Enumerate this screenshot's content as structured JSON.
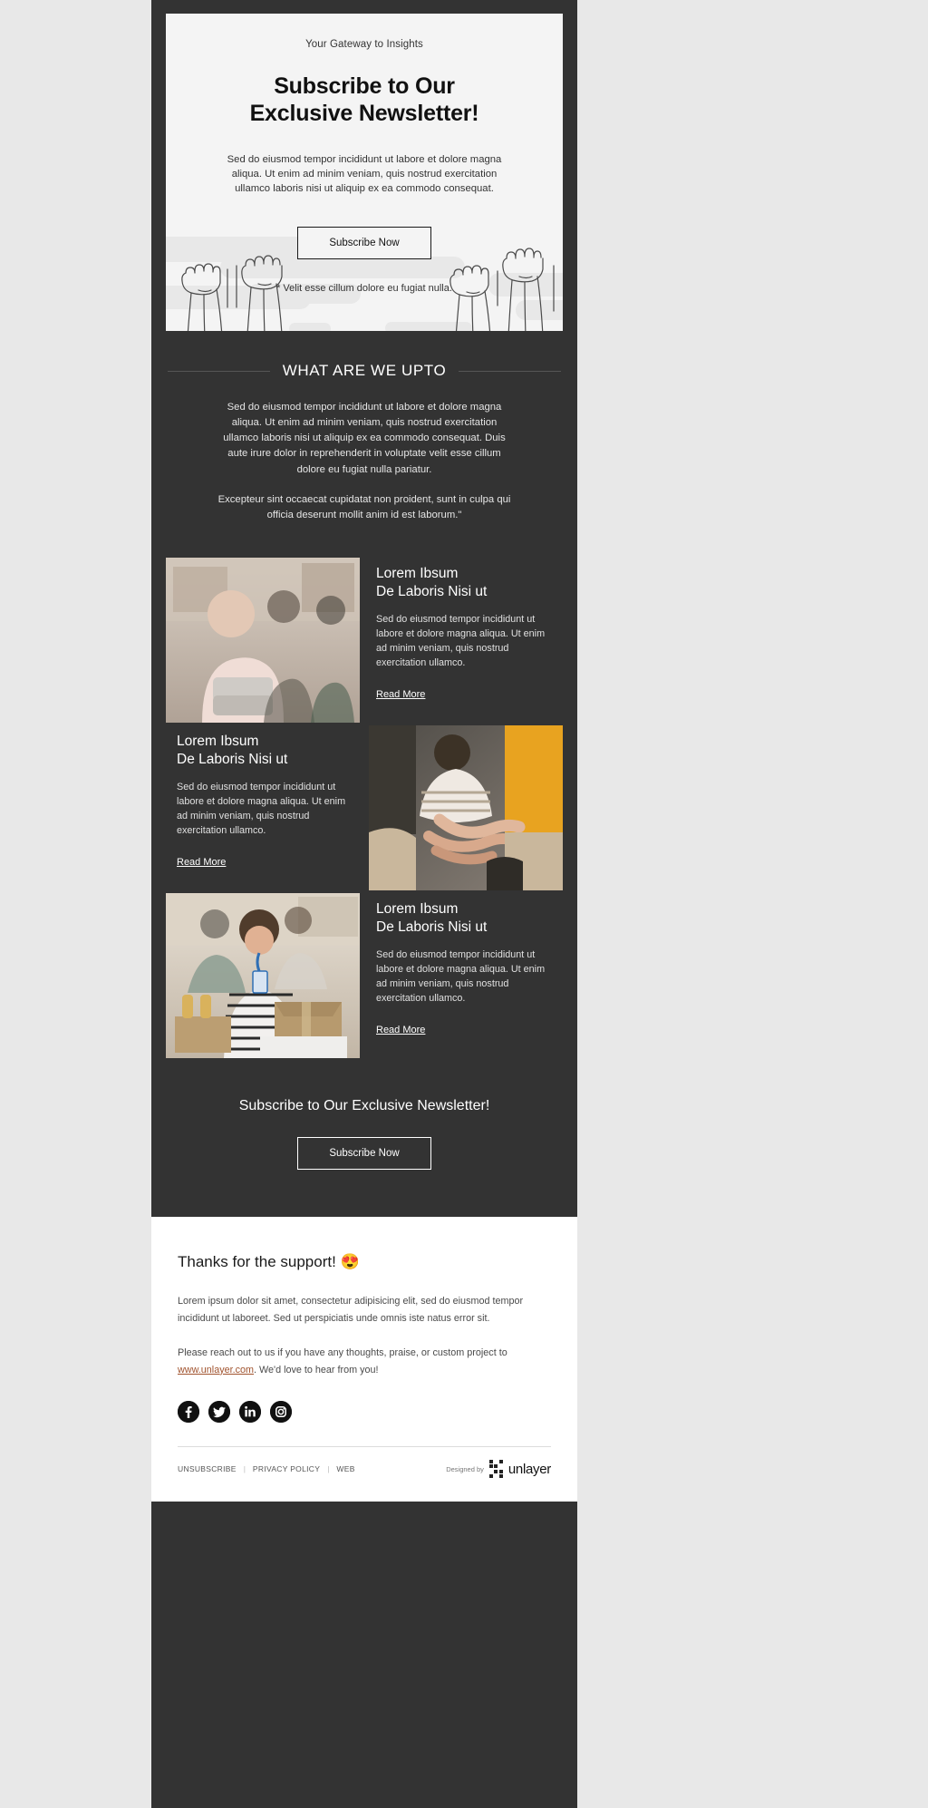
{
  "colors": {
    "email_bg": "#333333",
    "page_bg": "#e8e8e8",
    "hero_bg": "#f4f4f4",
    "footer_bg": "#ffffff",
    "accent_link": "#a0522d"
  },
  "hero": {
    "eyebrow": "Your Gateway to Insights",
    "title_line1": "Subscribe to Our",
    "title_line2": "Exclusive Newsletter!",
    "body": "Sed do eiusmod tempor incididunt ut labore et dolore magna aliqua. Ut enim ad minim veniam, quis nostrud exercitation ullamco laboris nisi ut aliquip ex ea commodo consequat.",
    "cta_label": "Subscribe Now",
    "note": "* Velit esse cillum dolore eu fugiat nulla."
  },
  "upto": {
    "title": "WHAT ARE WE UPTO",
    "paragraph1": "Sed do eiusmod tempor incididunt ut labore et dolore magna aliqua. Ut enim ad minim veniam, quis nostrud exercitation ullamco laboris nisi ut aliquip ex ea commodo consequat. Duis aute irure dolor in reprehenderit in voluptate velit esse cillum dolore eu fugiat nulla pariatur.",
    "paragraph2": "Excepteur sint occaecat cupidatat non proident, sunt in culpa qui officia deserunt mollit anim id est laborum.\""
  },
  "cards": [
    {
      "title_line1": "Lorem Ibsum",
      "title_line2": "De Laboris Nisi ut",
      "body": "Sed do eiusmod tempor incididunt ut labore et dolore magna aliqua. Ut enim ad minim veniam, quis nostrud exercitation ullamco.",
      "link_label": "Read More",
      "image_alt": "woman-holding-folded-blankets-in-store",
      "layout": "image-left"
    },
    {
      "title_line1": "Lorem Ibsum",
      "title_line2": "De Laboris Nisi ut",
      "body": "Sed do eiusmod tempor incididunt ut labore et dolore magna aliqua. Ut enim ad minim veniam, quis nostrud exercitation ullamco.",
      "link_label": "Read More",
      "image_alt": "team-hands-stacked-together",
      "layout": "image-right"
    },
    {
      "title_line1": "Lorem Ibsum",
      "title_line2": "De Laboris Nisi ut",
      "body": "Sed do eiusmod tempor incididunt ut labore et dolore magna aliqua. Ut enim ad minim veniam, quis nostrud exercitation ullamco.",
      "link_label": "Read More",
      "image_alt": "volunteer-woman-carrying-donation-box",
      "layout": "image-left"
    }
  ],
  "cta": {
    "title": "Subscribe to Our Exclusive Newsletter!",
    "button_label": "Subscribe Now"
  },
  "footer": {
    "thanks": "Thanks for the support! 😍",
    "paragraph1": "Lorem ipsum dolor sit amet, consectetur adipisicing elit, sed do eiusmod tempor incididunt ut laboreet. Sed ut perspiciatis unde omnis iste natus error sit.",
    "paragraph2_pre": "Please reach out to us if you have any thoughts, praise, or custom project to ",
    "paragraph2_link": "www.unlayer.com",
    "paragraph2_post": ". We'd love to hear from you!",
    "socials": [
      {
        "name": "facebook-icon",
        "glyph": "f"
      },
      {
        "name": "twitter-icon",
        "glyph": "t"
      },
      {
        "name": "linkedin-icon",
        "glyph": "in"
      },
      {
        "name": "instagram-icon",
        "glyph": "ig"
      }
    ],
    "legal": [
      {
        "label": "UNSUBSCRIBE"
      },
      {
        "label": "PRIVACY POLICY"
      },
      {
        "label": "WEB"
      }
    ],
    "separator": "|",
    "designed_by": "Designed by",
    "brand_name": "unlayer"
  }
}
